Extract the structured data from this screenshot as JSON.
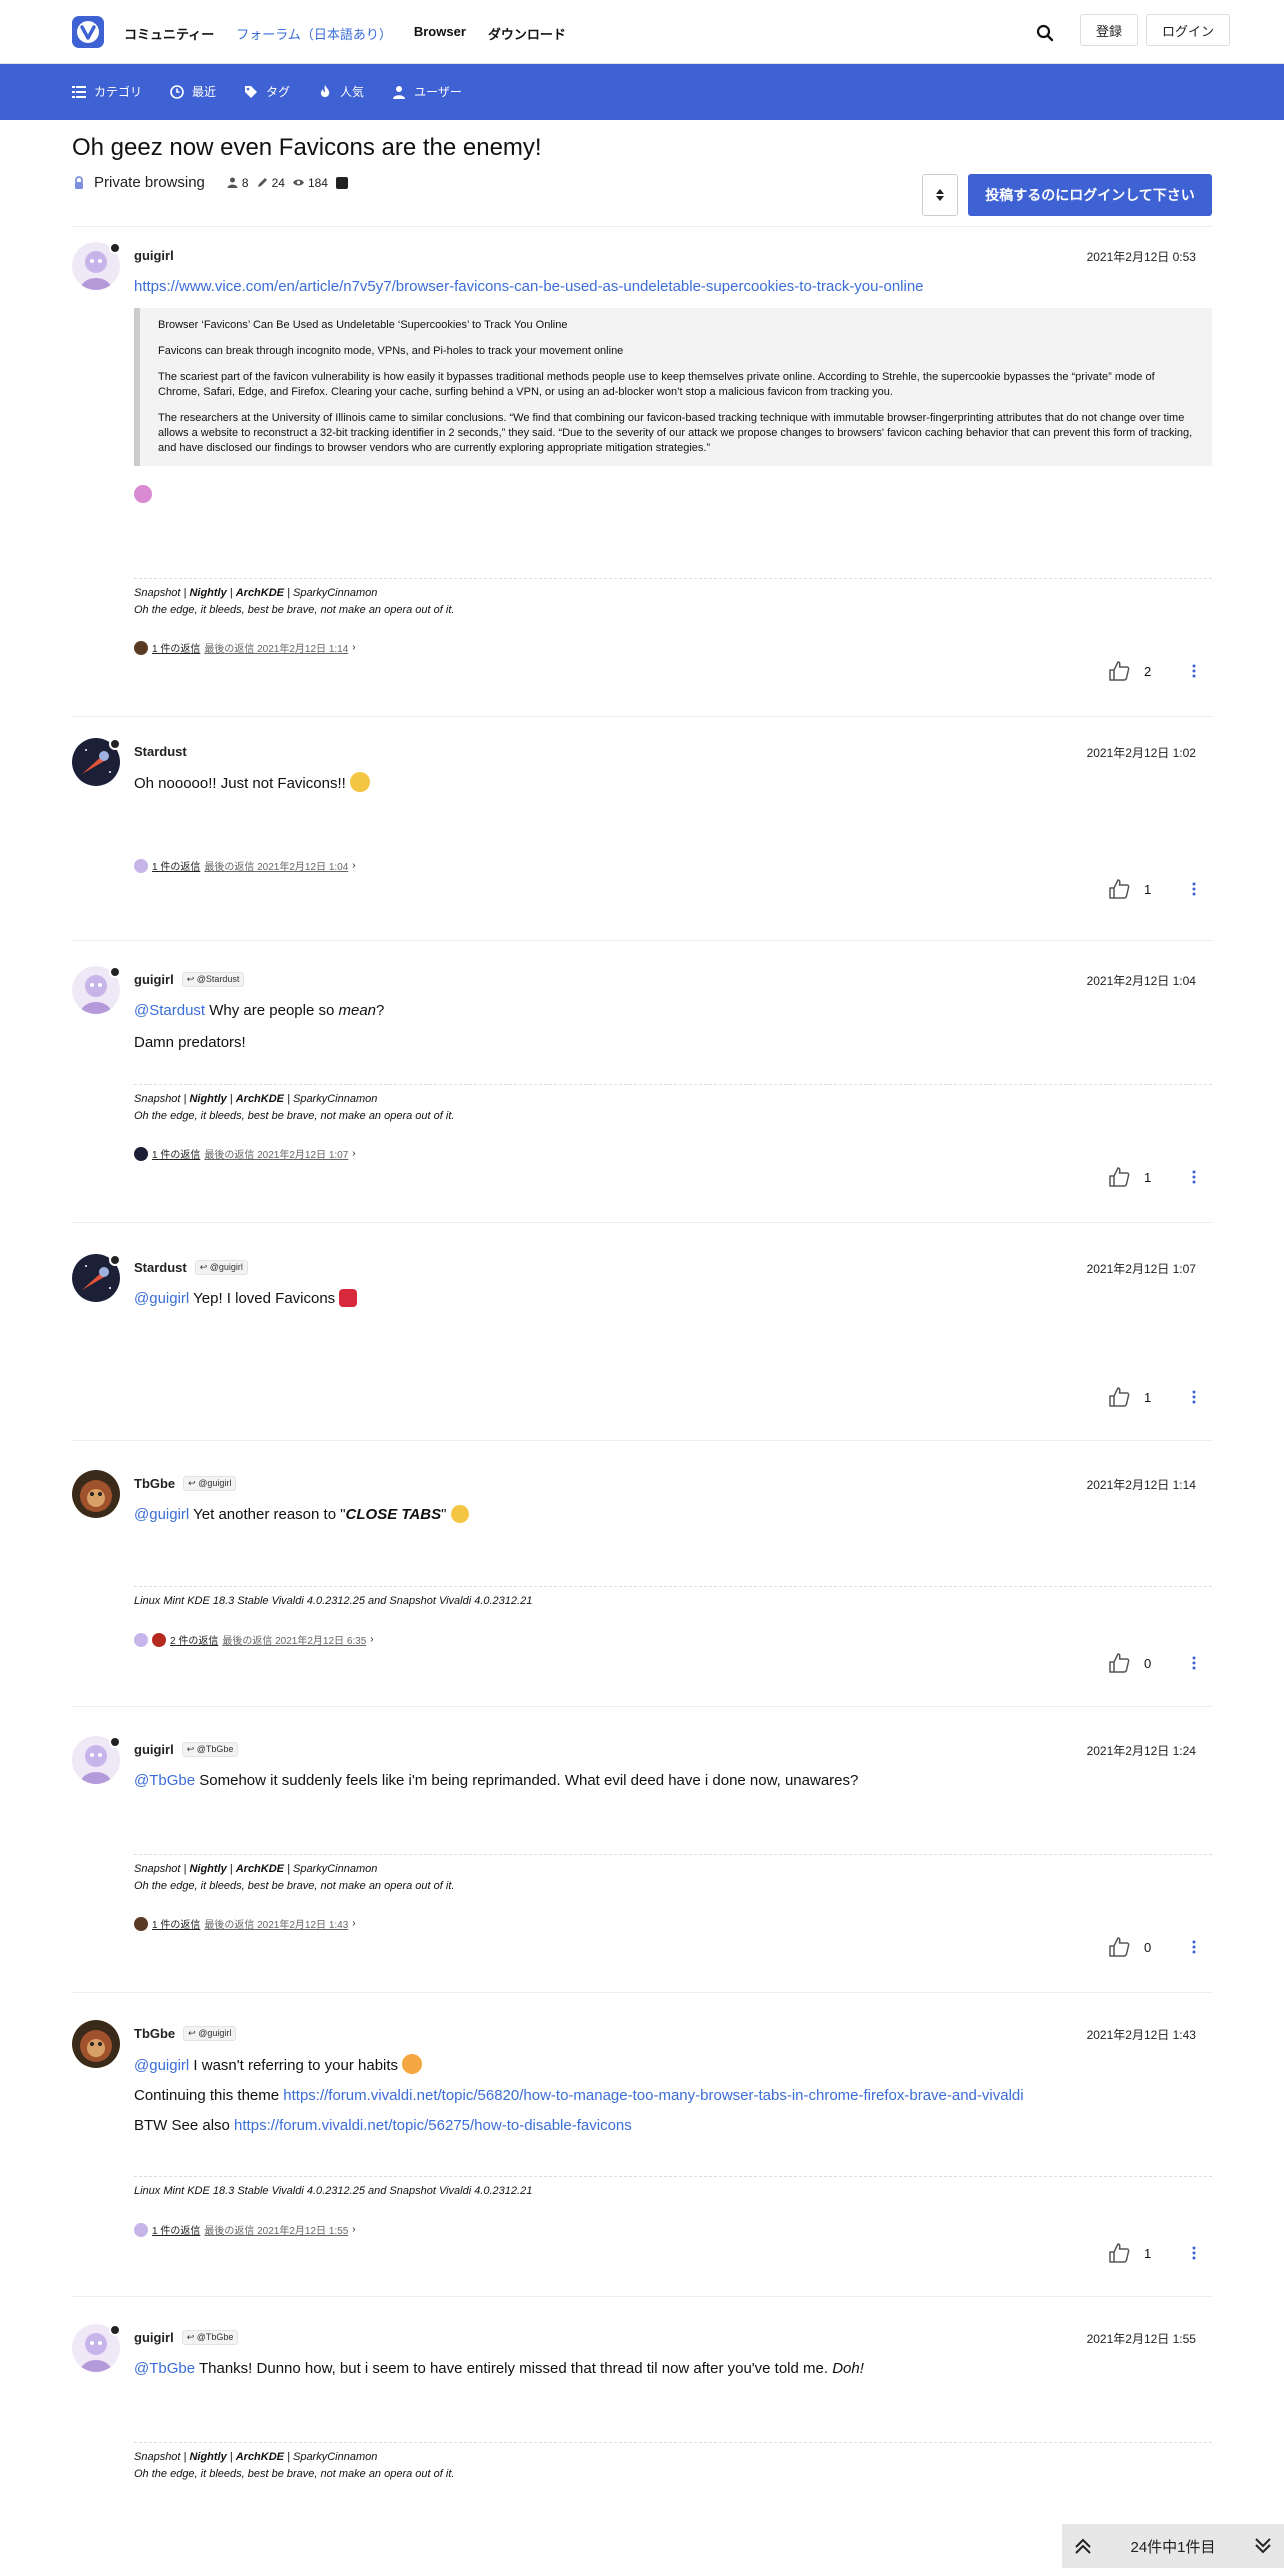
{
  "nav": {
    "community": "コミュニティー",
    "forum": "フォーラム（日本語あり）",
    "browser": "Browser",
    "download": "ダウンロード",
    "register": "登録",
    "login": "ログイン"
  },
  "subnav": {
    "categories": "カテゴリ",
    "recent": "最近",
    "tags": "タグ",
    "popular": "人気",
    "users": "ユーザー"
  },
  "topic": {
    "title": "Oh geez now even Favicons are the enemy!",
    "category": "Private browsing",
    "posters": "8",
    "posts": "24",
    "views": "184",
    "login_to_post": "投稿するのにログインして下さい"
  },
  "signatures": {
    "guigirl_line1_a": "Snapshot | ",
    "guigirl_line1_b": "Nightly",
    "guigirl_line1_c": " | ",
    "guigirl_line1_d": "ArchKDE",
    "guigirl_line1_e": " | SparkyCinnamon",
    "guigirl_line2": "Oh the edge, it bleeds, best be brave, not make an opera out of it.",
    "tbgbe": "Linux Mint KDE 18.3 Stable Vivaldi 4.0.2312.25 and Snapshot Vivaldi 4.0.2312.21"
  },
  "posts": [
    {
      "author": "guigirl",
      "timestamp": "2021年2月12日 0:53",
      "link": "https://www.vice.com/en/article/n7v5y7/browser-favicons-can-be-used-as-undeletable-supercookies-to-track-you-online",
      "quote": [
        "Browser ‘Favicons’ Can Be Used as Undeletable ‘Supercookies’ to Track You Online",
        "Favicons can break through incognito mode, VPNs, and Pi-holes to track your movement online",
        "The scariest part of the favicon vulnerability is how easily it bypasses traditional methods people use to keep themselves private online. According to Strehle, the supercookie bypasses the “private” mode of Chrome, Safari, Edge, and Firefox. Clearing your cache, surfing behind a VPN, or using an ad-blocker won’t stop a malicious favicon from tracking you.",
        "The researchers at the University of Illinois came to similar conclusions. “We find that combining our favicon-based tracking technique with immutable browser-fingerprinting attributes that do not change over time allows a website to reconstruct a 32-bit tracking identifier in 2 seconds,” they said. “Due to the severity of our attack we propose changes to browsers' favicon caching behavior that can prevent this form of tracking, and have disclosed our findings to browser vendors who are currently exploring appropriate mitigation strategies.”"
      ],
      "replies": "1 件の返信",
      "last_reply": "最後の返信 2021年2月12日 1:14",
      "votes": "2"
    },
    {
      "author": "Stardust",
      "timestamp": "2021年2月12日 1:02",
      "text": "Oh nooooo!! Just not Favicons!!",
      "replies": "1 件の返信",
      "last_reply": "最後の返信 2021年2月12日 1:04",
      "votes": "1"
    },
    {
      "author": "guigirl",
      "reply_to": "@Stardust",
      "timestamp": "2021年2月12日 1:04",
      "mention": "@Stardust",
      "text_a": " Why are people so ",
      "text_em": "mean",
      "text_b": "?",
      "text2": "Damn predators!",
      "replies": "1 件の返信",
      "last_reply": "最後の返信 2021年2月12日 1:07",
      "votes": "1"
    },
    {
      "author": "Stardust",
      "reply_to": "@guigirl",
      "timestamp": "2021年2月12日 1:07",
      "mention": "@guigirl",
      "text": " Yep! I loved Favicons",
      "votes": "1"
    },
    {
      "author": "TbGbe",
      "reply_to": "@guigirl",
      "timestamp": "2021年2月12日 1:14",
      "mention": "@guigirl",
      "text_a": " Yet another reason to \"",
      "text_em": "CLOSE TABS",
      "text_b": "\"",
      "replies": "2 件の返信",
      "last_reply": "最後の返信 2021年2月12日 6:35",
      "votes": "0"
    },
    {
      "author": "guigirl",
      "reply_to": "@TbGbe",
      "timestamp": "2021年2月12日 1:24",
      "mention": "@TbGbe",
      "text": " Somehow it suddenly feels like i'm being reprimanded. What evil deed have i done now, unawares?",
      "replies": "1 件の返信",
      "last_reply": "最後の返信 2021年2月12日 1:43",
      "votes": "0"
    },
    {
      "author": "TbGbe",
      "reply_to": "@guigirl",
      "timestamp": "2021年2月12日 1:43",
      "mention": "@guigirl",
      "text": " I wasn't referring to your habits",
      "text2": "Continuing this theme ",
      "link2": "https://forum.vivaldi.net/topic/56820/how-to-manage-too-many-browser-tabs-in-chrome-firefox-brave-and-vivaldi",
      "text3": "BTW See also ",
      "link3": "https://forum.vivaldi.net/topic/56275/how-to-disable-favicons",
      "replies": "1 件の返信",
      "last_reply": "最後の返信 2021年2月12日 1:55",
      "votes": "1"
    },
    {
      "author": "guigirl",
      "reply_to": "@TbGbe",
      "timestamp": "2021年2月12日 1:55",
      "mention": "@TbGbe",
      "text": " Thanks! Dunno how, but i seem to have entirely missed that thread til now after you've told me. ",
      "text_em": "Doh!"
    }
  ],
  "pager": {
    "label": "24件中1件目"
  }
}
